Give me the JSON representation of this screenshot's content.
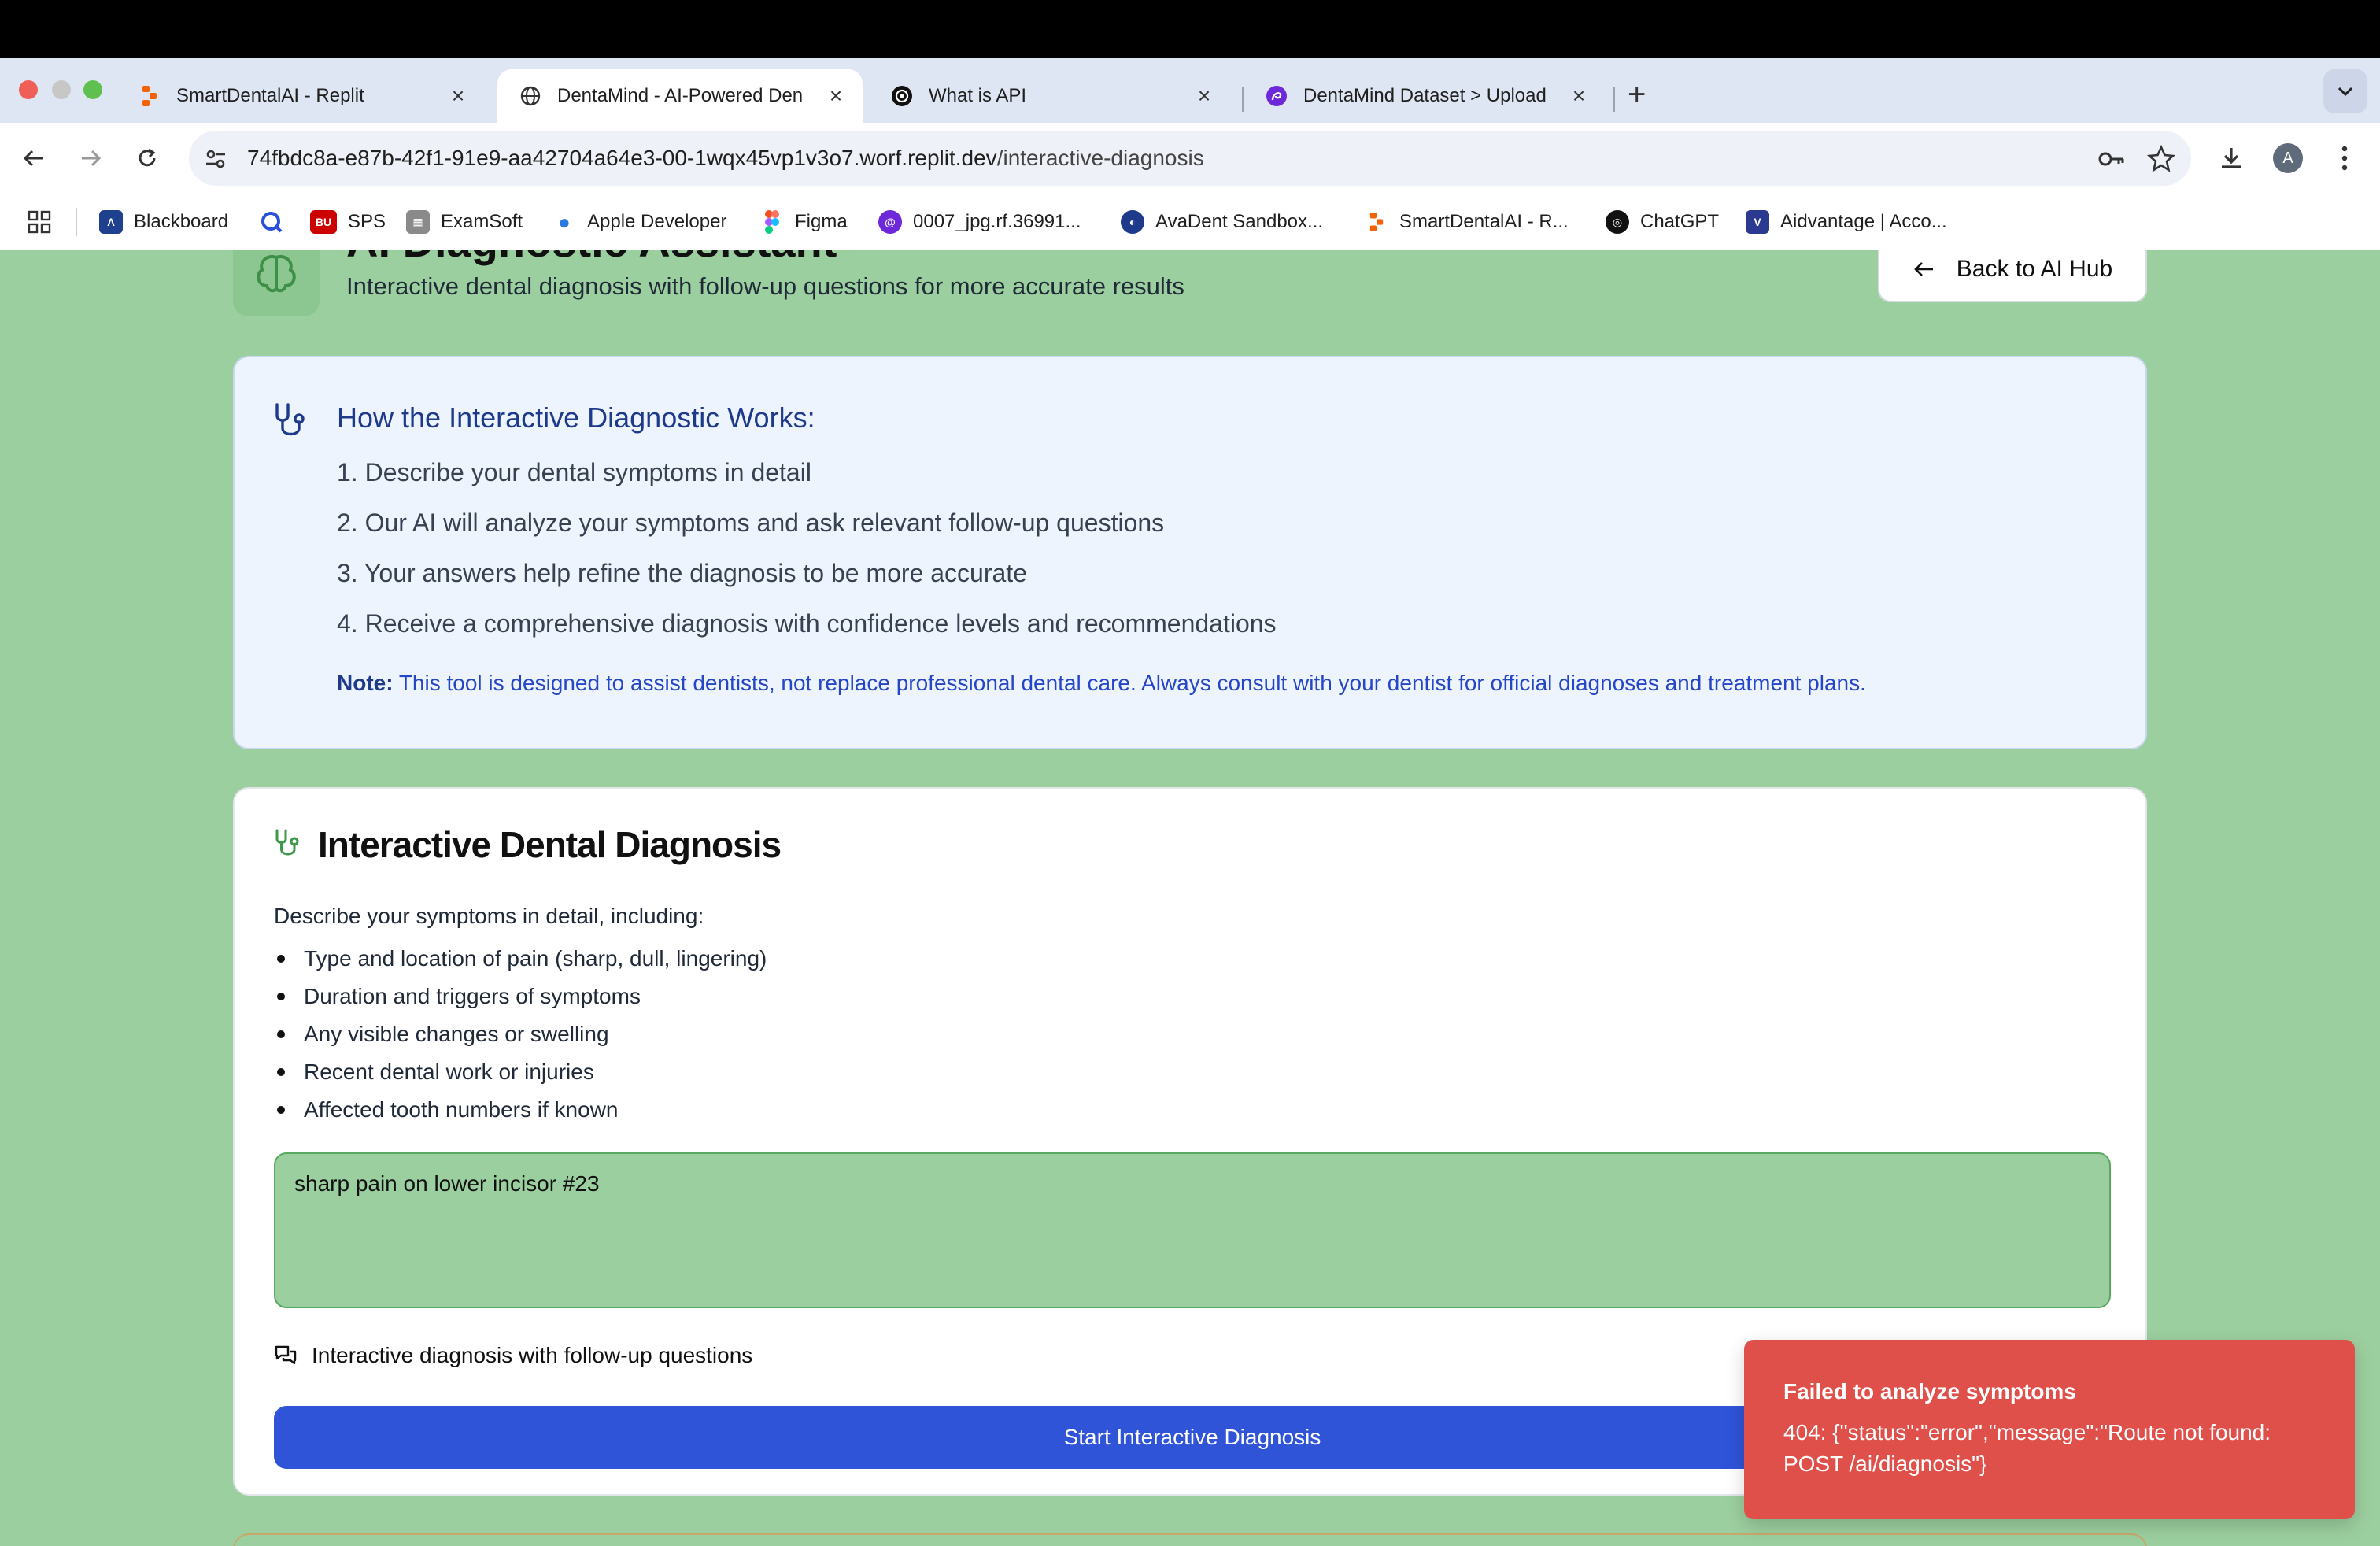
{
  "browser": {
    "tabs": [
      {
        "title": "SmartDentalAI - Replit",
        "active": false
      },
      {
        "title": "DentaMind - AI-Powered Den",
        "active": true
      },
      {
        "title": "What is API",
        "active": false
      },
      {
        "title": "DentaMind Dataset > Upload",
        "active": false
      }
    ],
    "url_host": "74fbdc8a-e87b-42f1-91e9-aa42704a64e3-00-1wqx45vp1v3o7.worf.replit.dev",
    "url_path": "/interactive-diagnosis",
    "profile_initial": "A",
    "bookmarks": [
      {
        "label": "",
        "icon": "apps-grid-icon"
      },
      {
        "label": "Blackboard",
        "icon": "blackboard-icon"
      },
      {
        "label": "",
        "icon": "q-icon"
      },
      {
        "label": "SPS",
        "icon": "bu-icon",
        "badge": "BU"
      },
      {
        "label": "ExamSoft",
        "icon": "examsoft-icon"
      },
      {
        "label": "Apple Developer",
        "icon": "apple-icon"
      },
      {
        "label": "Figma",
        "icon": "figma-icon"
      },
      {
        "label": "0007_jpg.rf.36991...",
        "icon": "roboflow-icon"
      },
      {
        "label": "AvaDent Sandbox...",
        "icon": "avadent-icon"
      },
      {
        "label": "SmartDentalAI - R...",
        "icon": "replit-icon"
      },
      {
        "label": "ChatGPT",
        "icon": "openai-icon"
      },
      {
        "label": "Aidvantage | Acco...",
        "icon": "aidvantage-icon"
      }
    ]
  },
  "header": {
    "title": "AI Diagnostic Assistant",
    "subtitle": "Interactive dental diagnosis with follow-up questions for more accurate results",
    "back_label": "Back to AI Hub"
  },
  "info": {
    "title": "How the Interactive Diagnostic Works:",
    "steps": [
      "1. Describe your dental symptoms in detail",
      "2. Our AI will analyze your symptoms and ask relevant follow-up questions",
      "3. Your answers help refine the diagnosis to be more accurate",
      "4. Receive a comprehensive diagnosis with confidence levels and recommendations"
    ],
    "note_label": "Note:",
    "note_text": " This tool is designed to assist dentists, not replace professional dental care. Always consult with your dentist for official diagnoses and treatment plans."
  },
  "diagnosis": {
    "title": "Interactive Dental Diagnosis",
    "intro": "Describe your symptoms in detail, including:",
    "bullets": [
      "Type and location of pain (sharp, dull, lingering)",
      "Duration and triggers of symptoms",
      "Any visible changes or swelling",
      "Recent dental work or injuries",
      "Affected tooth numbers if known"
    ],
    "symptom_value": "sharp pain on lower incisor #23",
    "mode_label": "Interactive diagnosis with follow-up questions",
    "start_label": "Start Interactive Diagnosis"
  },
  "toast": {
    "title": "Failed to analyze symptoms",
    "message": "404: {\"status\":\"error\",\"message\":\"Route not found: POST /ai/diagnosis\"}"
  },
  "colors": {
    "page_bg": "#9ccf9f",
    "primary": "#2f54d8",
    "info_title": "#1e3a8a",
    "toast_bg": "#e0504b"
  }
}
